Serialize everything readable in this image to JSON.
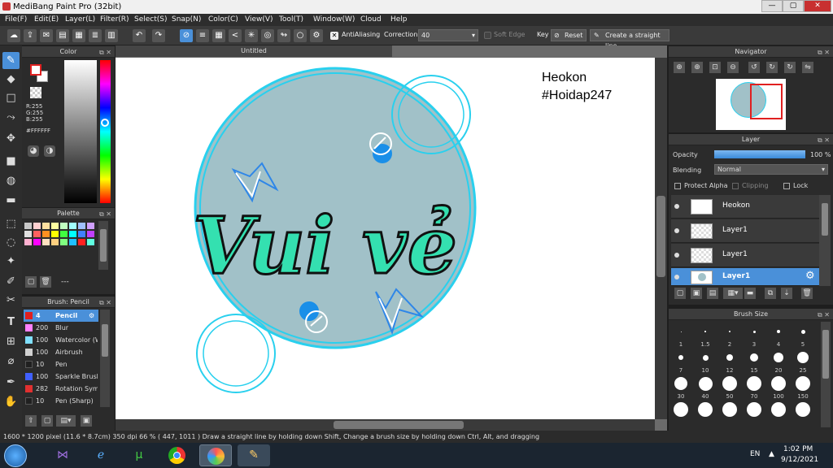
{
  "window": {
    "title": "MediBang Paint Pro (32bit)",
    "minimize": "—",
    "maximize": "▢",
    "close": "✕"
  },
  "menu": [
    "File(F)",
    "Edit(E)",
    "Layer(L)",
    "Filter(R)",
    "Select(S)",
    "Snap(N)",
    "Color(C)",
    "View(V)",
    "Tool(T)",
    "Window(W)",
    "Cloud",
    "Help"
  ],
  "toolbar": {
    "antialiasing_label": "AntiAliasing",
    "correction_label": "Correction",
    "correction_value": "40",
    "soft_edge_label": "Soft Edge",
    "key_label": "Key",
    "reset_label": "Reset",
    "straight_line_label": "Create a straight line"
  },
  "color_panel": {
    "title": "Color",
    "r": "R:255",
    "g": "G:255",
    "b": "B:255",
    "hex": "#FFFFFF",
    "fg": "#e02020",
    "bg": "#ffffff"
  },
  "palette_panel": {
    "title": "Palette",
    "colors": [
      "#c8c8c8",
      "#ffd0d0",
      "#ffe0a0",
      "#ffffa0",
      "#c0ffc0",
      "#a0ffff",
      "#a0c0ff",
      "#d0a0ff",
      "#e0e0e0",
      "#ff6060",
      "#ff9020",
      "#ffff00",
      "#40ff40",
      "#00ffff",
      "#4080ff",
      "#c040ff",
      "#ffb0d0",
      "#ff00ff",
      "#ffe0c0",
      "#ffd080",
      "#80ff80",
      "#20c0ff",
      "#ff2020",
      "#60ffe0"
    ],
    "footer": "---"
  },
  "brush_panel": {
    "title": "Brush: Pencil",
    "items": [
      {
        "size": "4",
        "name": "Pencil",
        "color": "#e02020"
      },
      {
        "size": "200",
        "name": "Blur",
        "color": "#ff80ff"
      },
      {
        "size": "100",
        "name": "Watercolor (W",
        "color": "#80e0ff"
      },
      {
        "size": "100",
        "name": "Airbrush",
        "color": "#d0d0d0"
      },
      {
        "size": "10",
        "name": "Pen",
        "color": "#202020"
      },
      {
        "size": "100",
        "name": "Sparkle Brush",
        "color": "#4060ff"
      },
      {
        "size": "282",
        "name": "Rotation Sym",
        "color": "#e03030"
      },
      {
        "size": "10",
        "name": "Pen (Sharp)",
        "color": "#202020"
      }
    ]
  },
  "document": {
    "tab_title": "Untitled",
    "watermark_line1": "Heokon",
    "watermark_line2": "#Hoidap247",
    "artwork_text": "Vui vẻ"
  },
  "navigator": {
    "title": "Navigator"
  },
  "layer_panel": {
    "title": "Layer",
    "opacity_label": "Opacity",
    "opacity_value": "100 %",
    "opacity_fraction": 1.0,
    "blending_label": "Blending",
    "blending_value": "Normal",
    "protect_alpha": "Protect Alpha",
    "clipping": "Clipping",
    "lock": "Lock",
    "layers": [
      {
        "name": "Heokon"
      },
      {
        "name": "Layer1"
      },
      {
        "name": "Layer1"
      },
      {
        "name": "Layer1"
      }
    ]
  },
  "brush_size_panel": {
    "title": "Brush Size",
    "sizes": [
      "1",
      "1.5",
      "2",
      "3",
      "4",
      "5",
      "7",
      "10",
      "12",
      "15",
      "20",
      "25",
      "30",
      "40",
      "50",
      "70",
      "100",
      "150",
      "",
      "",
      "",
      "",
      "",
      ""
    ]
  },
  "status": {
    "text": "1600 * 1200 pixel   (11.6 * 8.7cm)   350 dpi   66 %   ( 447, 1011 )   Draw a straight line by holding down Shift, Change a brush size by holding down Ctrl, Alt, and dragging"
  },
  "taskbar": {
    "lang": "EN",
    "time": "1:02 PM",
    "date": "9/12/2021"
  }
}
